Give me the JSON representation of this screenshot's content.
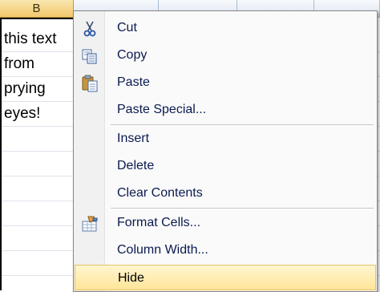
{
  "sheet": {
    "column_b": "B",
    "cells": [
      "this text",
      "from",
      "prying",
      "eyes!"
    ]
  },
  "context_menu": {
    "items": [
      {
        "label": "Cut",
        "icon": "scissors-icon"
      },
      {
        "label": "Copy",
        "icon": "copy-icon"
      },
      {
        "label": "Paste",
        "icon": "paste-icon"
      },
      {
        "label": "Paste Special...",
        "icon": ""
      },
      {
        "label": "Insert",
        "icon": ""
      },
      {
        "label": "Delete",
        "icon": ""
      },
      {
        "label": "Clear Contents",
        "icon": ""
      },
      {
        "label": "Format Cells...",
        "icon": "format-cells-icon"
      },
      {
        "label": "Column Width...",
        "icon": ""
      },
      {
        "label": "Hide",
        "icon": "",
        "highlighted": true
      }
    ]
  },
  "colors": {
    "highlight": "#ffe599",
    "selected_header": "#f2c86b"
  }
}
